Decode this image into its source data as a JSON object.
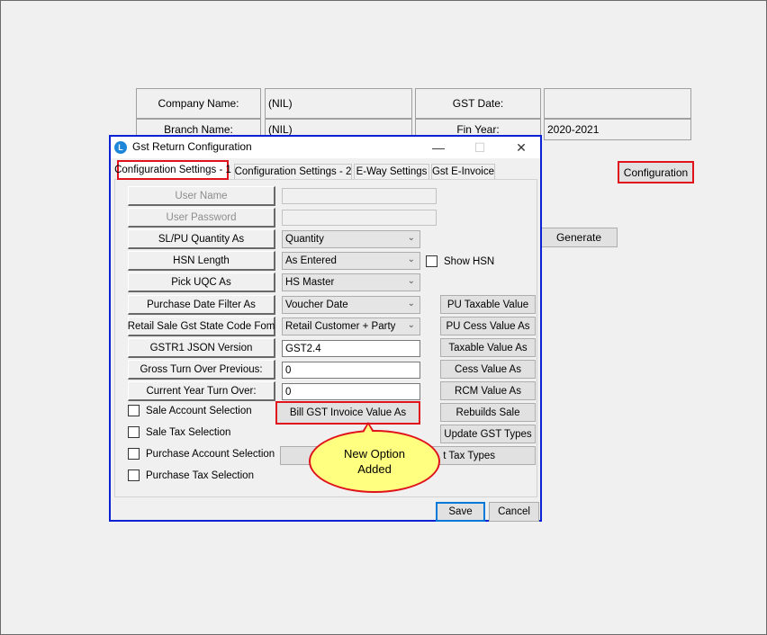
{
  "header": {
    "company_label": "Company Name:",
    "company_value": "(NIL)",
    "gst_date_label": "GST Date:",
    "gst_date_value": "",
    "branch_label": "Branch Name:",
    "branch_value": "(NIL)",
    "fin_year_label": "Fin Year:",
    "fin_year_value": "2020-2021"
  },
  "background_buttons": {
    "configuration": "Configuration",
    "generate": "Generate"
  },
  "dialog": {
    "title": "Gst Return Configuration",
    "controls": {
      "minimize": "—",
      "maximize": "☐",
      "close": "✕"
    },
    "tabs": [
      "Configuration Settings - 1",
      "Configuration Settings - 2",
      "E-Way Settings",
      "Gst E-Invoice"
    ],
    "fields": {
      "user_name": "User Name",
      "user_password": "User Password",
      "qty_label": "SL/PU Quantity As",
      "qty_value": "Quantity",
      "hsn_label": "HSN Length",
      "hsn_value": "As Entered",
      "uqc_label": "Pick UQC As",
      "uqc_value": "HS Master",
      "pdate_label": "Purchase Date Filter As",
      "pdate_value": "Voucher Date",
      "state_label": "Retail Sale Gst State Code Fom",
      "state_value": "Retail Customer + Party",
      "json_label": "GSTR1 JSON Version",
      "json_value": "GST2.4",
      "gto_prev_label": "Gross Turn Over Previous:",
      "gto_prev_value": "0",
      "cur_year_label": "Current Year Turn Over:",
      "cur_year_value": "0"
    },
    "show_hsn": "Show HSN",
    "checkboxes": [
      "Sale Account Selection",
      "Sale Tax Selection",
      "Purchase Account Selection",
      "Purchase Tax Selection"
    ],
    "right_buttons": [
      "PU Taxable Value",
      "PU Cess Value As",
      "Taxable Value As",
      "Cess Value As",
      "RCM Value As",
      "Rebuilds Sale",
      "Update GST Types",
      "t Tax Types"
    ],
    "bill_button": "Bill GST Invoice Value As",
    "save": "Save",
    "cancel": "Cancel"
  },
  "callout": {
    "line1": "New  Option",
    "line2": "Added"
  }
}
